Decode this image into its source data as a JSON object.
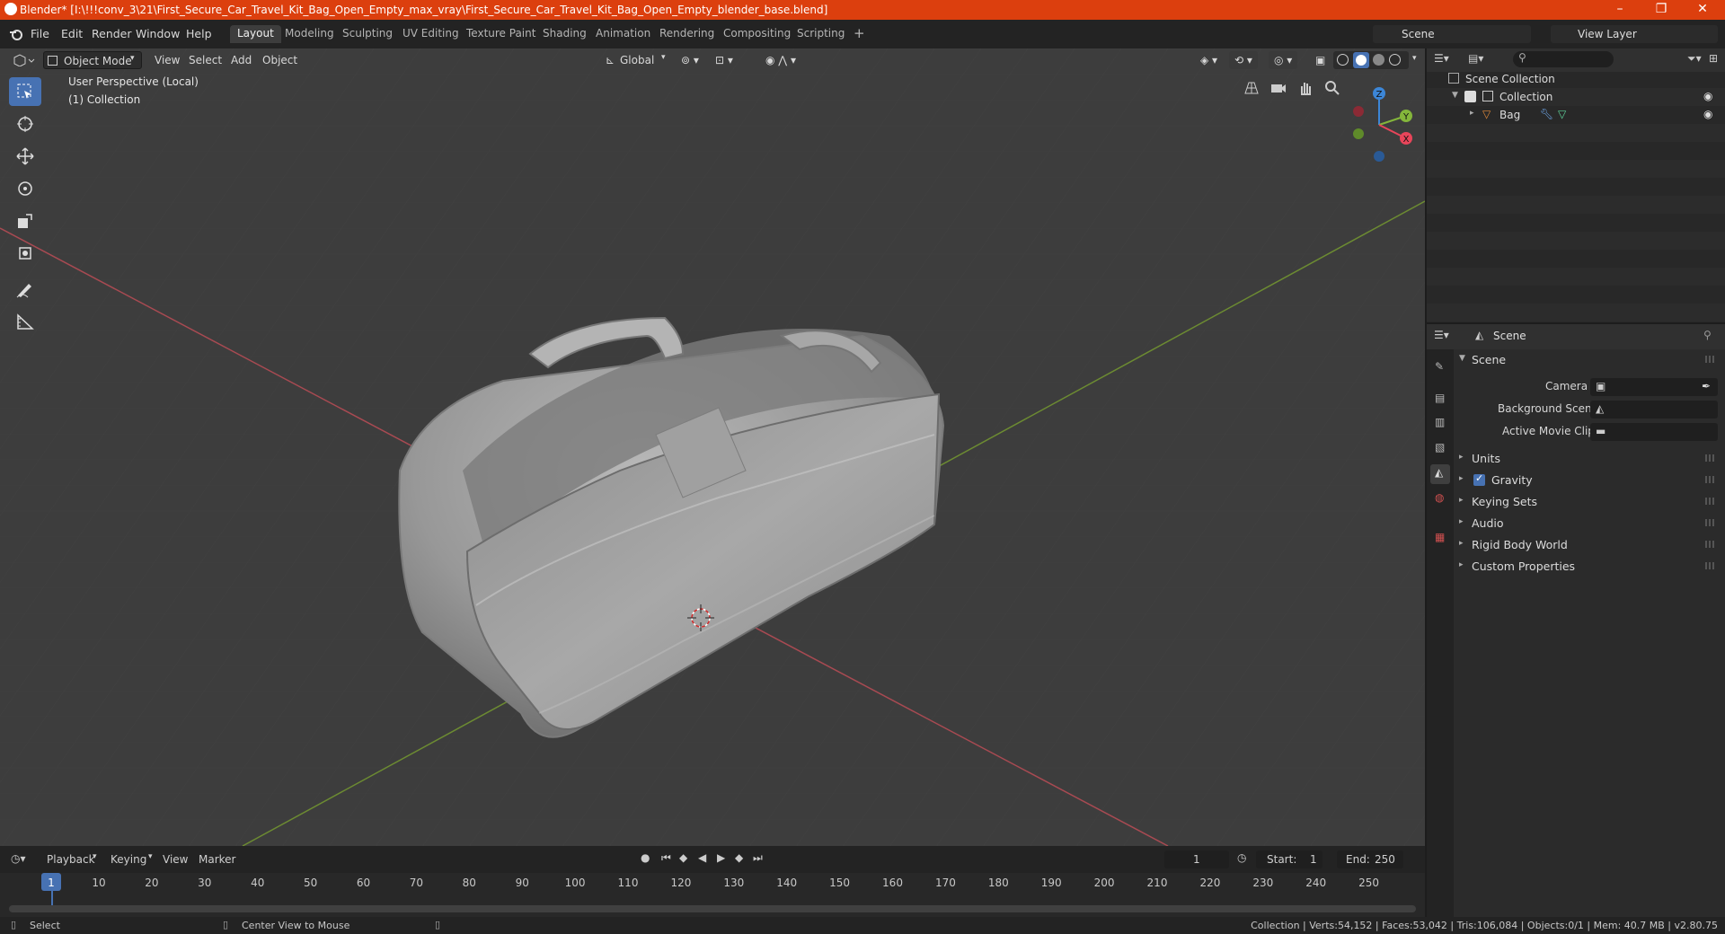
{
  "window": {
    "title": "Blender* [I:\\!!!conv_3\\21\\First_Secure_Car_Travel_Kit_Bag_Open_Empty_max_vray\\First_Secure_Car_Travel_Kit_Bag_Open_Empty_blender_base.blend]",
    "minimize": "–",
    "maximize": "❐",
    "close": "✕"
  },
  "menu": [
    "File",
    "Edit",
    "Render",
    "Window",
    "Help"
  ],
  "workspaces": [
    "Layout",
    "Modeling",
    "Sculpting",
    "UV Editing",
    "Texture Paint",
    "Shading",
    "Animation",
    "Rendering",
    "Compositing",
    "Scripting"
  ],
  "active_workspace": "Layout",
  "add_workspace": "+",
  "scene_name": "Scene",
  "view_layer": "View Layer",
  "viewport": {
    "mode": "Object Mode",
    "menus": [
      "View",
      "Select",
      "Add",
      "Object"
    ],
    "orientation": "Global",
    "overlay_line1": "User Perspective (Local)",
    "overlay_line2": "(1) Collection",
    "gizmo": {
      "x": "X",
      "y": "Y",
      "z": "Z"
    }
  },
  "outliner": {
    "search_placeholder": "",
    "rows": [
      {
        "label": "Scene Collection"
      },
      {
        "label": "Collection"
      },
      {
        "label": "Bag"
      }
    ]
  },
  "properties": {
    "header": "Scene",
    "panel_title": "Scene",
    "fields": [
      {
        "label": "Camera",
        "value": ""
      },
      {
        "label": "Background Scene",
        "value": ""
      },
      {
        "label": "Active Movie Clip",
        "value": ""
      }
    ],
    "subpanels": [
      "Units",
      "Gravity",
      "Keying Sets",
      "Audio",
      "Rigid Body World",
      "Custom Properties"
    ],
    "gravity_enabled": true
  },
  "timeline": {
    "menus": [
      "Playback",
      "Keying",
      "View",
      "Marker"
    ],
    "current_frame": "1",
    "start_label": "Start:",
    "start": "1",
    "end_label": "End:",
    "end": "250",
    "ruler": [
      "1",
      "10",
      "20",
      "30",
      "40",
      "50",
      "60",
      "70",
      "80",
      "90",
      "100",
      "110",
      "120",
      "130",
      "140",
      "150",
      "160",
      "170",
      "180",
      "190",
      "200",
      "210",
      "220",
      "230",
      "240",
      "250"
    ]
  },
  "status": {
    "left1": "Select",
    "left2": "Center View to Mouse",
    "right": "Collection | Verts:54,152 | Faces:53,042 | Tris:106,084 | Objects:0/1 | Mem: 40.7 MB | v2.80.75"
  },
  "colors": {
    "titlebar": "#dc3f0e",
    "accent": "#4772b3",
    "x_axis": "#e8455a",
    "y_axis": "#84b63b",
    "z_axis": "#3c86d7"
  }
}
